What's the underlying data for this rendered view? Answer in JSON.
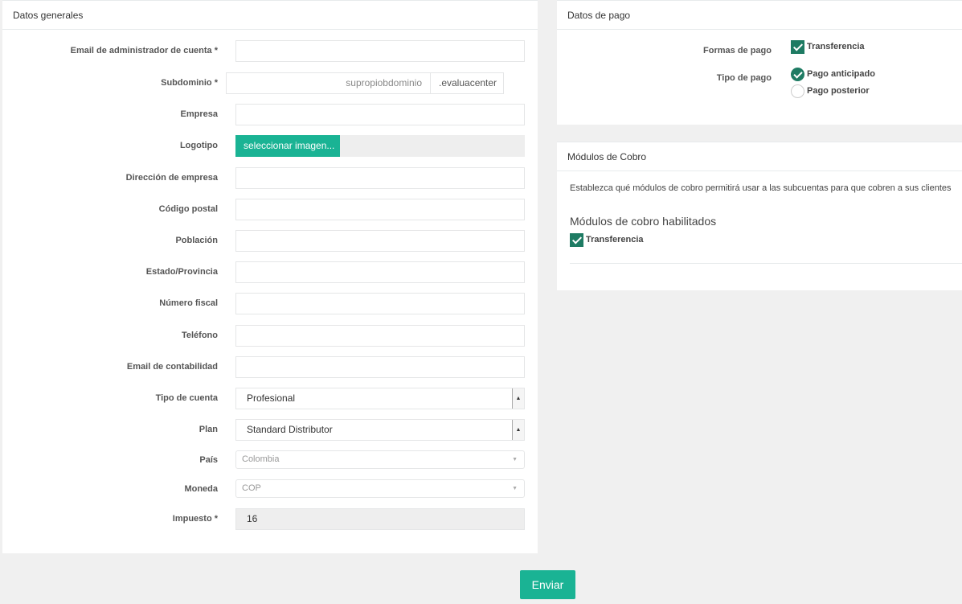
{
  "general": {
    "title": "Datos generales",
    "email_admin_label": "Email de administrador de cuenta *",
    "email_admin_value": "",
    "subdomain_label": "Subdominio *",
    "subdomain_placeholder": "supropiobdominio",
    "subdomain_suffix": ".evaluacenter",
    "company_label": "Empresa",
    "company_value": "",
    "logo_label": "Logotipo",
    "logo_button": "seleccionar imagen...",
    "address_label": "Dirección de empresa",
    "address_value": "",
    "postal_label": "Código postal",
    "postal_value": "",
    "city_label": "Población",
    "city_value": "",
    "state_label": "Estado/Provincia",
    "state_value": "",
    "tax_number_label": "Número fiscal",
    "tax_number_value": "",
    "phone_label": "Teléfono",
    "phone_value": "",
    "accounting_email_label": "Email de contabilidad",
    "accounting_email_value": "",
    "account_type_label": "Tipo de cuenta",
    "account_type_value": "Profesional",
    "plan_label": "Plan",
    "plan_value": "Standard Distributor",
    "country_label": "País",
    "country_value": "Colombia",
    "currency_label": "Moneda",
    "currency_value": "COP",
    "tax_label": "Impuesto *",
    "tax_value": "16"
  },
  "payment": {
    "title": "Datos de pago",
    "methods_label": "Formas de pago",
    "method_transfer": "Transferencia",
    "type_label": "Tipo de pago",
    "type_advance": "Pago anticipado",
    "type_later": "Pago posterior"
  },
  "modules": {
    "title": "Módulos de Cobro",
    "description": "Establezca qué módulos de cobro permitirá usar a las subcuentas para que cobren a sus clientes",
    "enabled_heading": "Módulos de cobro habilitados",
    "transfer": "Transferencia"
  },
  "submit_label": "Enviar",
  "colors": {
    "accent": "#1ab394",
    "check": "#1e7b63"
  }
}
